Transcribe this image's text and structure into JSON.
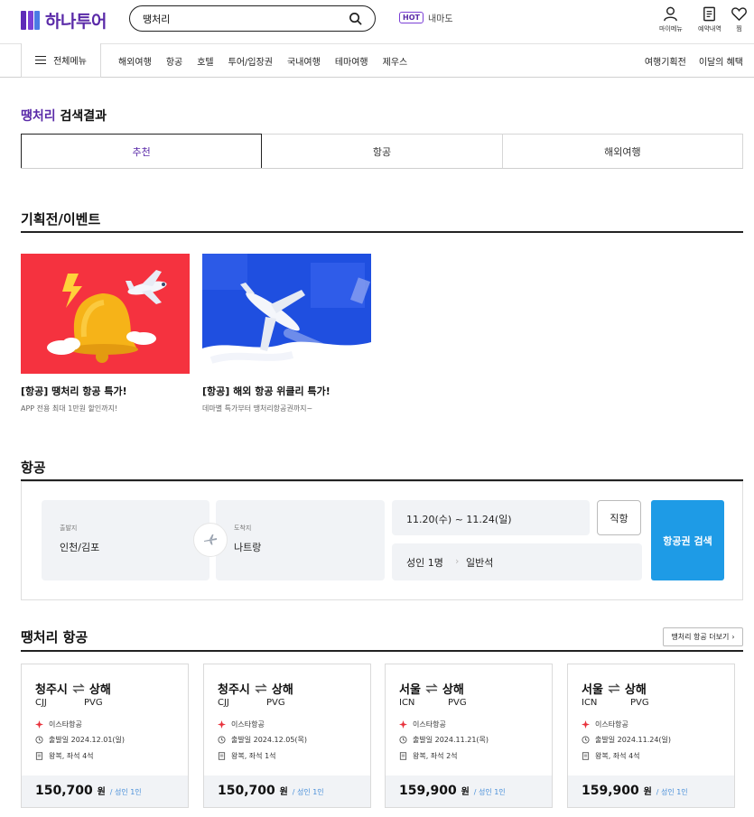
{
  "header": {
    "logo_text": "하나투어",
    "search_value": "땡처리",
    "hot_badge": "HOT",
    "hot_text": "내마도",
    "util": [
      "마이메뉴",
      "예약내역",
      "찜"
    ]
  },
  "nav": {
    "all_menu": "전체메뉴",
    "items": [
      "해외여행",
      "항공",
      "호텔",
      "투어/입장권",
      "국내여행",
      "테마여행",
      "제우스"
    ],
    "right": [
      "여행기획전",
      "이달의 혜택"
    ]
  },
  "result": {
    "keyword": "땡처리",
    "title_suffix": "검색결과",
    "tabs": [
      "추천",
      "항공",
      "해외여행"
    ]
  },
  "events": {
    "title": "기획전/이벤트",
    "items": [
      {
        "title": "[항공] 땡처리 항공 특가!",
        "sub": "APP 전용 최대 1만원 할인까지!"
      },
      {
        "title": "[항공] 해외 항공 위클리 특가!",
        "sub": "데마별 특가부터 땡처리항공권까지~"
      }
    ]
  },
  "flight": {
    "title": "항공",
    "from_label": "출발지",
    "from_value": "인천/김포",
    "to_label": "도착지",
    "to_value": "나트랑",
    "dates": "11.20(수) ~ 11.24(일)",
    "pax": "성인 1명",
    "seat": "일반석",
    "direct": "직항",
    "search": "항공권 검색"
  },
  "deals": {
    "title": "땡처리 항공",
    "more": "땡처리 항공 더보기",
    "items": [
      {
        "from": "청주시",
        "to": "상해",
        "from_code": "CJJ",
        "to_code": "PVG",
        "airline": "이스타항공",
        "date": "출발일 2024.12.01(일)",
        "trip": "왕복, 좌석 4석",
        "price": "150,700",
        "won": "원",
        "pax": "/ 성인 1인"
      },
      {
        "from": "청주시",
        "to": "상해",
        "from_code": "CJJ",
        "to_code": "PVG",
        "airline": "이스타항공",
        "date": "출발일 2024.12.05(목)",
        "trip": "왕복, 좌석 1석",
        "price": "150,700",
        "won": "원",
        "pax": "/ 성인 1인"
      },
      {
        "from": "서울",
        "to": "상해",
        "from_code": "ICN",
        "to_code": "PVG",
        "airline": "이스타항공",
        "date": "출발일 2024.11.21(목)",
        "trip": "왕복, 좌석 2석",
        "price": "159,900",
        "won": "원",
        "pax": "/ 성인 1인"
      },
      {
        "from": "서울",
        "to": "상해",
        "from_code": "ICN",
        "to_code": "PVG",
        "airline": "이스타항공",
        "date": "출발일 2024.11.24(일)",
        "trip": "왕복, 좌석 4석",
        "price": "159,900",
        "won": "원",
        "pax": "/ 성인 1인"
      }
    ]
  },
  "colors": {
    "brand": "#5a2aa8",
    "accent": "#1e9be6",
    "airline": "#e8323c"
  }
}
